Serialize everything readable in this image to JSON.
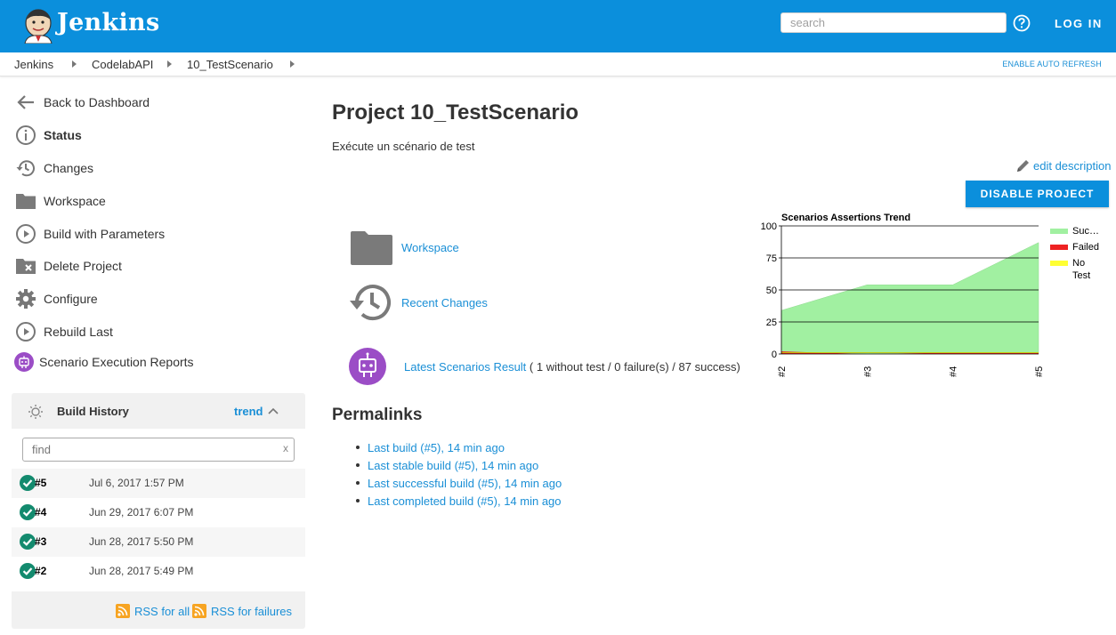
{
  "header": {
    "app_name": "Jenkins",
    "search_placeholder": "search",
    "login_label": "LOG IN",
    "help_icon": "help-circle-icon",
    "brand_color": "#0b8fdc"
  },
  "breadcrumb": {
    "items": [
      "Jenkins",
      "CodelabAPI",
      "10_TestScenario"
    ],
    "auto_refresh": "ENABLE AUTO REFRESH"
  },
  "sidebar": {
    "items": [
      {
        "label": "Back to Dashboard",
        "icon": "arrow-left-icon"
      },
      {
        "label": "Status",
        "icon": "info-icon"
      },
      {
        "label": "Changes",
        "icon": "history-icon"
      },
      {
        "label": "Workspace",
        "icon": "folder-icon"
      },
      {
        "label": "Build with Parameters",
        "icon": "play-circle-icon"
      },
      {
        "label": "Delete Project",
        "icon": "folder-delete-icon"
      },
      {
        "label": "Configure",
        "icon": "gear-icon"
      },
      {
        "label": "Rebuild Last",
        "icon": "play-circle-icon"
      },
      {
        "label": "Scenario Execution Reports",
        "icon": "robot-icon"
      }
    ]
  },
  "build_history": {
    "title": "Build History",
    "trend_label": "trend",
    "find_placeholder": "find",
    "clear_label": "x",
    "builds": [
      {
        "number": "#5",
        "date": "Jul 6, 2017 1:57 PM"
      },
      {
        "number": "#4",
        "date": "Jun 29, 2017 6:07 PM"
      },
      {
        "number": "#3",
        "date": "Jun 28, 2017 5:50 PM"
      },
      {
        "number": "#2",
        "date": "Jun 28, 2017 5:49 PM"
      }
    ],
    "rss_all": "RSS for all",
    "rss_failures": "RSS for failures"
  },
  "main": {
    "title": "Project 10_TestScenario",
    "description": "Exécute un scénario de test",
    "edit_description": "edit description",
    "disable_button": "DISABLE PROJECT",
    "links": {
      "workspace": "Workspace",
      "recent_changes": "Recent Changes",
      "latest_result": "Latest Scenarios Result",
      "latest_summary": " ( 1 without test / 0 failure(s) / 87 success)"
    },
    "permalinks_title": "Permalinks",
    "permalinks": [
      "Last build (#5), 14 min ago",
      "Last stable build (#5), 14 min ago",
      "Last successful build (#5), 14 min ago",
      "Last completed build (#5), 14 min ago"
    ]
  },
  "chart_data": {
    "type": "area",
    "title": "Scenarios Assertions Trend",
    "categories": [
      "#2",
      "#3",
      "#4",
      "#5"
    ],
    "ylim": [
      0,
      100
    ],
    "yticks": [
      0,
      25,
      50,
      75,
      100
    ],
    "grid": true,
    "legend_position": "right",
    "series": [
      {
        "name": "Suc…",
        "values": [
          34,
          54,
          54,
          87
        ],
        "color": "#a1f0a1"
      },
      {
        "name": "Failed",
        "values": [
          2,
          0,
          1,
          1
        ],
        "color": "#ee2222"
      },
      {
        "name": "No Test",
        "values": [
          1,
          1,
          1,
          1
        ],
        "color": "#ffff33"
      }
    ]
  }
}
